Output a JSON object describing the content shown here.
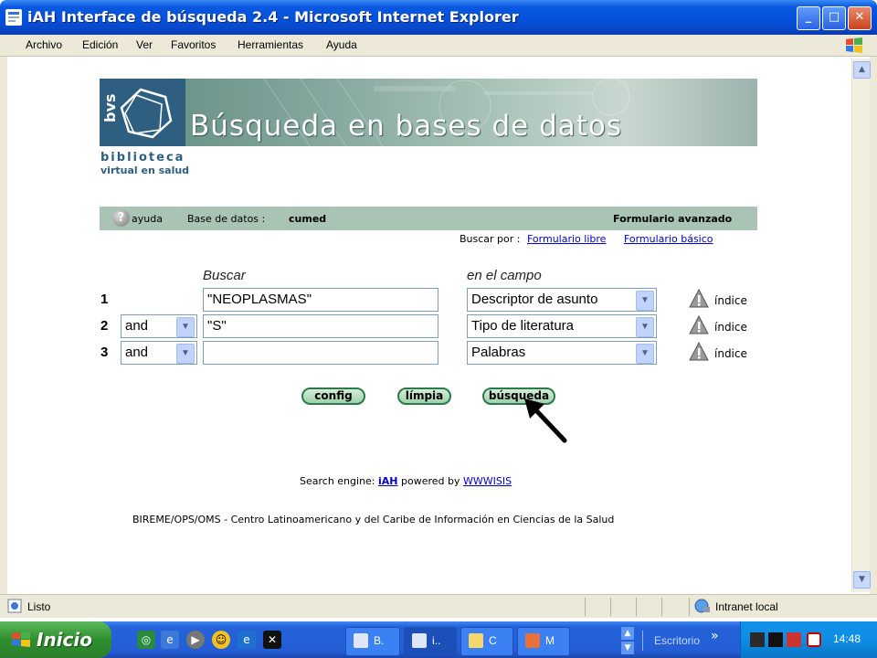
{
  "window": {
    "title": "iAH Interface de búsqueda 2.4 - Microsoft Internet Explorer",
    "minimize": "_",
    "maximize": "□",
    "close": "✕"
  },
  "menu": [
    "Archivo",
    "Edición",
    "Ver",
    "Favoritos",
    "Herramientas",
    "Ayuda"
  ],
  "banner": {
    "logo_text": "bvs",
    "title": "Búsqueda en bases de datos",
    "subtitle_line1": "biblioteca",
    "subtitle_line2": "virtual en salud"
  },
  "infobar": {
    "help_label": "ayuda",
    "database_prefix": "Base de datos :",
    "database_name": "cumed",
    "form_name": "Formulario avanzado"
  },
  "search_by": {
    "label": "Buscar por :",
    "link_free": "Formulario libre",
    "link_basic": "Formulario básico"
  },
  "form": {
    "col_search": "Buscar",
    "col_field": "en el campo",
    "rows": [
      {
        "num": "1",
        "operator": "",
        "term": "\"NEOPLASMAS\"",
        "field": "Descriptor de asunto",
        "index": "índice"
      },
      {
        "num": "2",
        "operator": "and",
        "term": "\"S\"",
        "field": "Tipo de literatura",
        "index": "índice"
      },
      {
        "num": "3",
        "operator": "and",
        "term": "",
        "field": "Palabras",
        "index": "índice"
      }
    ],
    "buttons": {
      "config": "config",
      "clear": "límpia",
      "search": "búsqueda"
    }
  },
  "footer": {
    "engine_prefix": "Search engine:",
    "engine_link": "iAH",
    "powered_by": "powered by",
    "wwwisis_link": "WWWISIS",
    "institution": "BIREME/OPS/OMS - Centro Latinoamericano y del Caribe de Información en Ciencias de la Salud"
  },
  "status": {
    "text": "Listo",
    "zone": "Intranet local"
  },
  "taskbar": {
    "start": "Inicio",
    "tasks": [
      "B.",
      "i..",
      "C",
      "M"
    ],
    "desk_label": "Escritorio",
    "chevron": "»",
    "clock": "14:48"
  },
  "colors": {
    "xp_blue": "#0550d8",
    "banner_green": "#86a89f",
    "infobar_green": "#a9c3b4",
    "link": "#0000cc"
  }
}
